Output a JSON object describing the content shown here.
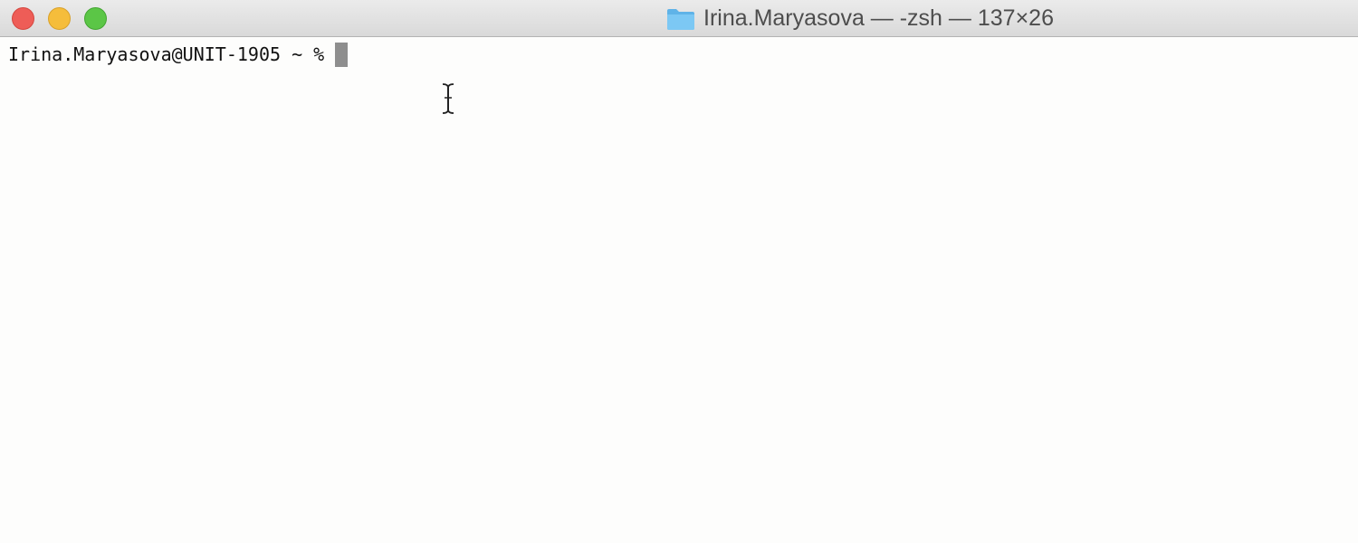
{
  "window": {
    "title": "Irina.Maryasova — -zsh — 137×26",
    "title_icon": "folder-icon",
    "controls": [
      "close",
      "minimize",
      "zoom"
    ],
    "colors": {
      "close": "#ee5d57",
      "minimize": "#f5bd3b",
      "zoom": "#5bc646",
      "folder": "#6cc0f0"
    }
  },
  "terminal": {
    "prompt": "Irina.Maryasova@UNIT-1905 ~ %",
    "input": "",
    "mouse_cursor": "i-beam-icon"
  }
}
